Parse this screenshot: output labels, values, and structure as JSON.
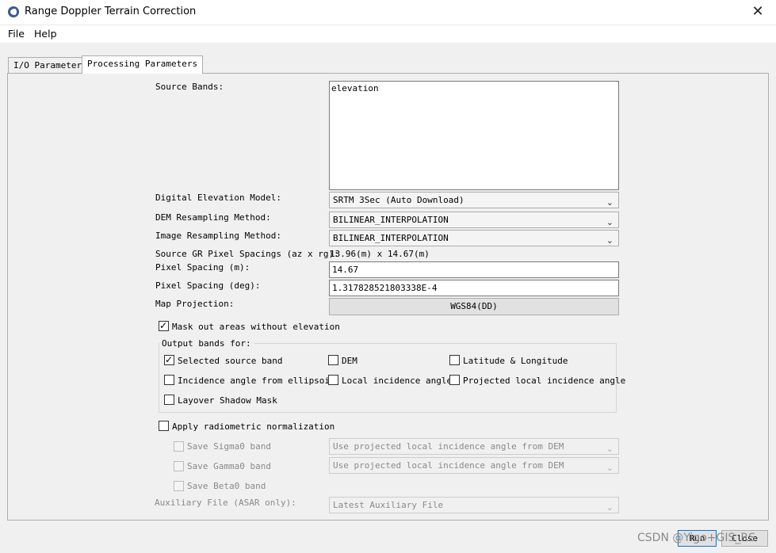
{
  "window": {
    "title": "Range Doppler Terrain Correction",
    "close_glyph": "✕"
  },
  "menu": [
    "File",
    "Help"
  ],
  "tabs": [
    "I/O Parameters",
    "Processing Parameters"
  ],
  "form": {
    "source_bands_label": "Source Bands:",
    "source_bands": [
      "elevation"
    ],
    "dem_label": "Digital Elevation Model:",
    "dem_value": "SRTM 3Sec (Auto Download)",
    "dem_resampling_label": "DEM Resampling Method:",
    "dem_resampling_value": "BILINEAR_INTERPOLATION",
    "image_resampling_label": "Image Resampling Method:",
    "image_resampling_value": "BILINEAR_INTERPOLATION",
    "gr_spacing_label": "Source GR Pixel Spacings (az x rg):",
    "gr_spacing_value": "13.96(m) x 14.67(m)",
    "pixel_spacing_m_label": "Pixel Spacing (m):",
    "pixel_spacing_m_value": "14.67",
    "pixel_spacing_deg_label": "Pixel Spacing (deg):",
    "pixel_spacing_deg_value": "1.317828521803338E-4",
    "map_projection_label": "Map Projection:",
    "map_projection_value": "WGS84(DD)",
    "mask_label": "Mask out areas without elevation",
    "output_bands_title": "Output bands for:",
    "out_selected": "Selected source band",
    "out_dem": "DEM",
    "out_latlon": "Latitude & Longitude",
    "out_incidence_ellipsoid": "Incidence angle from ellipsoid",
    "out_local_incidence": "Local incidence angle",
    "out_projected_local": "Projected local incidence angle",
    "out_layover": "Layover Shadow Mask",
    "radiometric_label": "Apply radiometric normalization",
    "sigma0_label": "Save Sigma0 band",
    "sigma0_value": "Use projected local incidence angle from DEM",
    "gamma0_label": "Save Gamma0 band",
    "gamma0_value": "Use projected local incidence angle from DEM",
    "beta0_label": "Save Beta0 band",
    "aux_label": "Auxiliary File (ASAR only):",
    "aux_value": "Latest Auxiliary File"
  },
  "footer": {
    "run_label": "Run",
    "close_label": "Close"
  },
  "watermark": "CSDN @Yigo+GIS_RS",
  "checked_glyph": "✓",
  "chevron_glyph": "⌄"
}
